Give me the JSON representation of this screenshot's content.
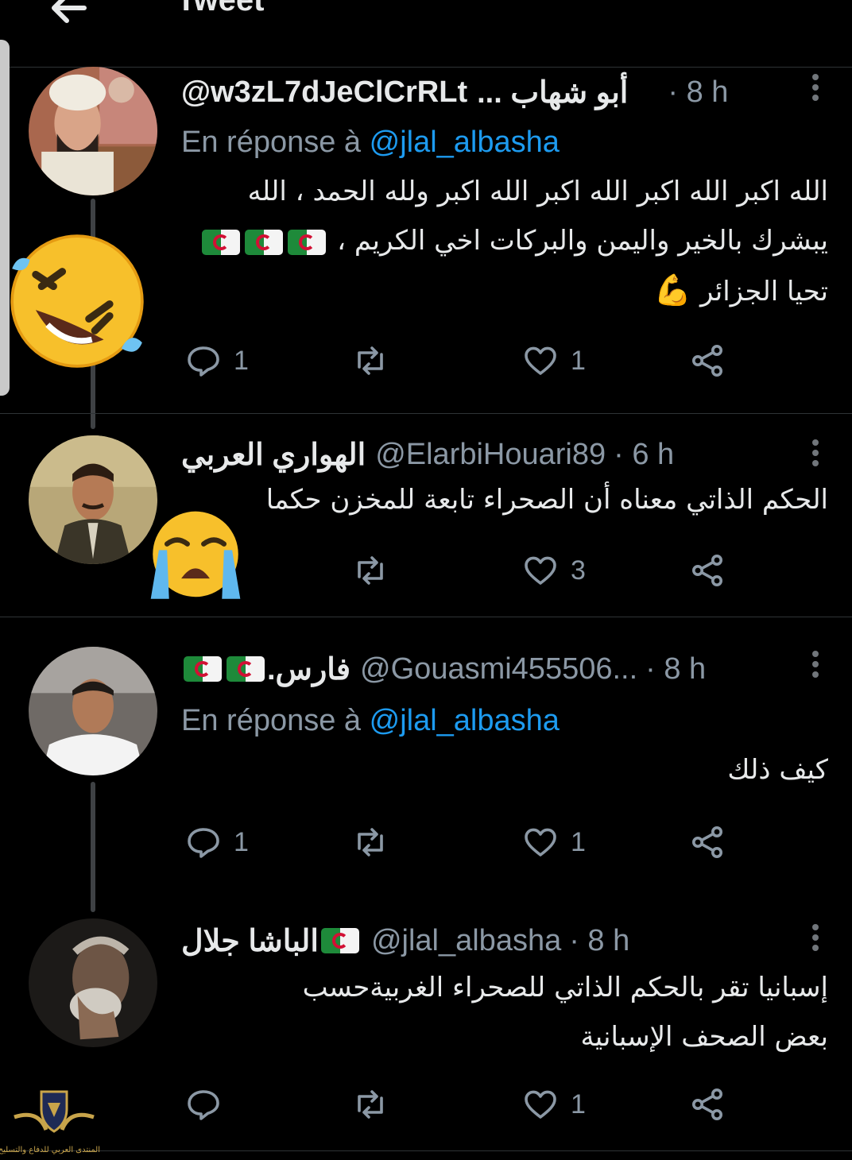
{
  "header": {
    "title": "Tweet"
  },
  "tweets": [
    {
      "display_name": "أبو شهاب ...",
      "handle": "@w3zL7dJeClCrRLt",
      "time": "· 8 h",
      "reply_prefix": "En réponse à",
      "reply_mention": "@jlal_albasha",
      "body_lines": [
        "الله اكبر الله اكبر الله اكبر الله اكبر ولله الحمد ، الله",
        "يبشرك بالخير واليمن والبركات اخي الكريم ،",
        "تحيا الجزائر"
      ],
      "replies": "1",
      "retweets": "",
      "likes": "1"
    },
    {
      "display_name": "الهواري العربي",
      "handle": "@ElarbiHouari89",
      "time": "· 6 h",
      "body_lines": [
        "الحكم الذاتي معناه أن الصحراء تابعة للمخزن حكما"
      ],
      "replies": "",
      "retweets": "",
      "likes": "3"
    },
    {
      "display_name": "فارس.",
      "handle": "@Gouasmi455506...",
      "time": "· 8 h",
      "reply_prefix": "En réponse à",
      "reply_mention": "@jlal_albasha",
      "body_lines": [
        "كيف ذلك"
      ],
      "replies": "1",
      "retweets": "",
      "likes": "1"
    },
    {
      "display_name": "الباشا جلال",
      "handle": "@jlal_albasha",
      "time": "· 8 h",
      "body_lines": [
        "إسبانيا تقر بالحكم الذاتي للصحراء الغربيةحسب",
        "بعض الصحف الإسبانية"
      ],
      "replies": "",
      "retweets": "",
      "likes": "1"
    }
  ],
  "watermark": {
    "text": "المنتدى العربي للدفاع والتسليح"
  },
  "colors": {
    "background": "#000000",
    "accent": "#1d9bf0",
    "muted": "#8b98a5",
    "text": "#e7e9ea"
  }
}
